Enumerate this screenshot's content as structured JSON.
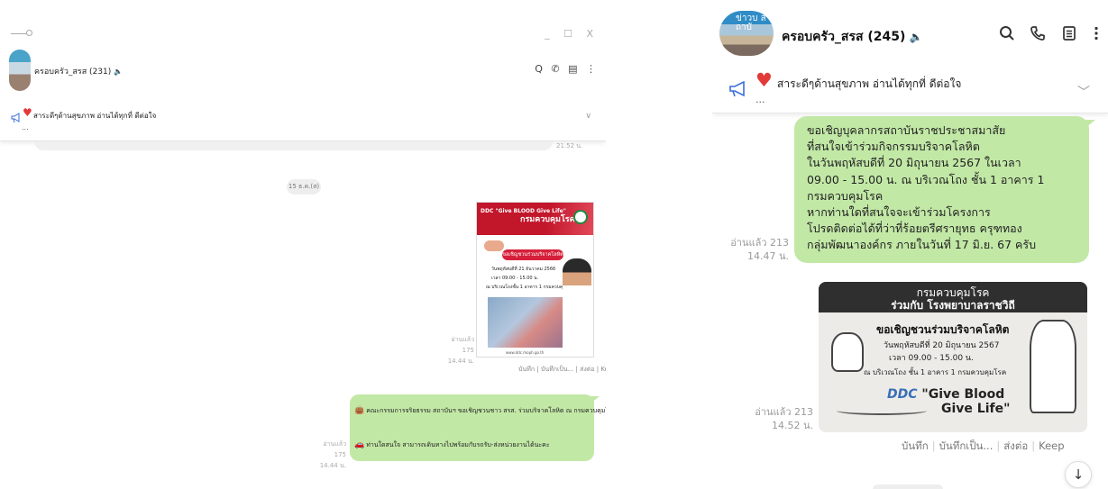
{
  "left": {
    "window_controls": "_ ☐ X",
    "chat_name": "ครอบครัว_สรส (231)",
    "toolbar_icons": [
      "search-icon",
      "phone-icon",
      "notes-icon",
      "more-icon"
    ],
    "toolbar_glyphs": "Q ✆ ▤ ⋮",
    "announcement": {
      "text": "สาระดีๆด้านสุขภาพ อ่านได้ทุกที่ ดีต่อใจ",
      "ellipsis": "..."
    },
    "old_time": "21.52 น.",
    "date_chip": "15 ธ.ค.(ส)",
    "poster": {
      "ddc": "DDC \"Give BLOOD Give Life\"",
      "dept": "กรมควบคุมโรค",
      "banner": "ขอเชิญชวนร่วมบริจาคโลหิต",
      "line1": "วันพฤหัสบดีที่ 21 ธันวาคม 2566",
      "line2": "เวลา 09.00 - 15.00 น.",
      "line3": "ณ บริเวณโถงชั้น 1 อาคาร 1 กรมควบคุมโรค",
      "footer": "www.ddc.moph.go.th"
    },
    "image_read": "อ่านแล้ว 175",
    "image_time": "14.44 น.",
    "image_actions": "บันทึก | บันทึกเป็น... | ส่งต่อ | Keep",
    "bubble": {
      "row1": "คณะกรรมการจริยธรรม สถาบันฯ ขอเชิญชวนชาว สรส. ร่วมบริจาคโลหิต ณ กรมควบคุมโรค",
      "row2": "ท่านใดสนใจ สามารถเดินทางไปพร้อมกับรถรับ-ส่งหน่วยงานได้นะคะ"
    },
    "bubble_read": "อ่านแล้ว 175",
    "bubble_time": "14.44 น."
  },
  "right": {
    "chat_name": "ครอบครัว_สรส (245)",
    "avatar_text": "ข่าวบ สถาบั",
    "toolbar_icons": [
      "search-icon",
      "phone-icon",
      "notes-icon",
      "more-icon"
    ],
    "announcement": {
      "text": "สาระดีๆด้านสุขภาพ อ่านได้ทุกที่ ดีต่อใจ",
      "ellipsis": "..."
    },
    "message_lines": [
      "ขอเชิญบุคลากรสถาบันราชประชาสมาสัย",
      "ที่สนใจเข้าร่วมกิจกรรมบริจาคโลหิต",
      "ในวันพฤหัสบดีที่ 20 มิถุนายน 2567  ในเวลา",
      "09.00 - 15.00 น. ณ บริเวณโถง ชั้น 1 อาคาร 1",
      "กรมควบคุมโรค",
      "หากท่านใดที่สนใจจะเข้าร่วมโครงการ",
      "โปรดติดต่อได้ที่ว่าที่ร้อยตรีศรายุทธ  ครุฑทอง",
      "กลุ่มพัฒนาองค์กร ภายในวันที่ 17 มิ.ย. 67  ครับ"
    ],
    "message_read": "อ่านแล้ว 213",
    "message_time": "14.47 น.",
    "image": {
      "line1": "กรมควบคุมโรค",
      "line2": "ร่วมกับ โรงพยาบาลราชวิถี",
      "invite": "ขอเชิญชวนร่วมบริจาคโลหิต",
      "date": "วันพฤหัสบดีที่ 20 มิถุนายน 2567",
      "time": "เวลา 09.00 - 15.00 น.",
      "place": "ณ บริเวณโถง ชั้น 1 อาคาร 1 กรมควบคุมโรค",
      "ddc": "DDC",
      "slogan1": "\"Give Blood",
      "slogan2": "Give Life\""
    },
    "image_read": "อ่านแล้ว 213",
    "image_time": "14.52 น.",
    "actions": [
      "บันทึก",
      "บันทึกเป็น...",
      "ส่งต่อ",
      "Keep"
    ]
  }
}
